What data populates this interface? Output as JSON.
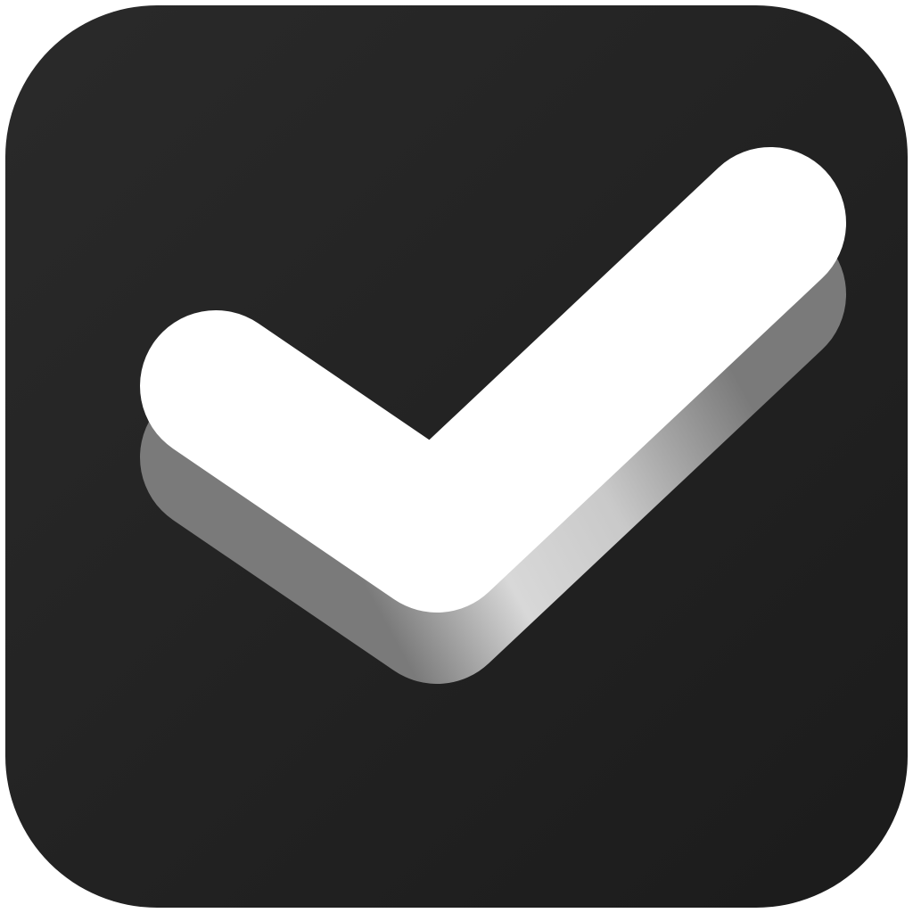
{
  "icon": {
    "name": "checkmark-icon",
    "background_color_top": "#2a2a2a",
    "background_color_bottom": "#1b1b1b",
    "check_color": "#ffffff",
    "check_shadow_light": "#d8d8d8",
    "check_shadow_dark": "#7a7a7a"
  }
}
